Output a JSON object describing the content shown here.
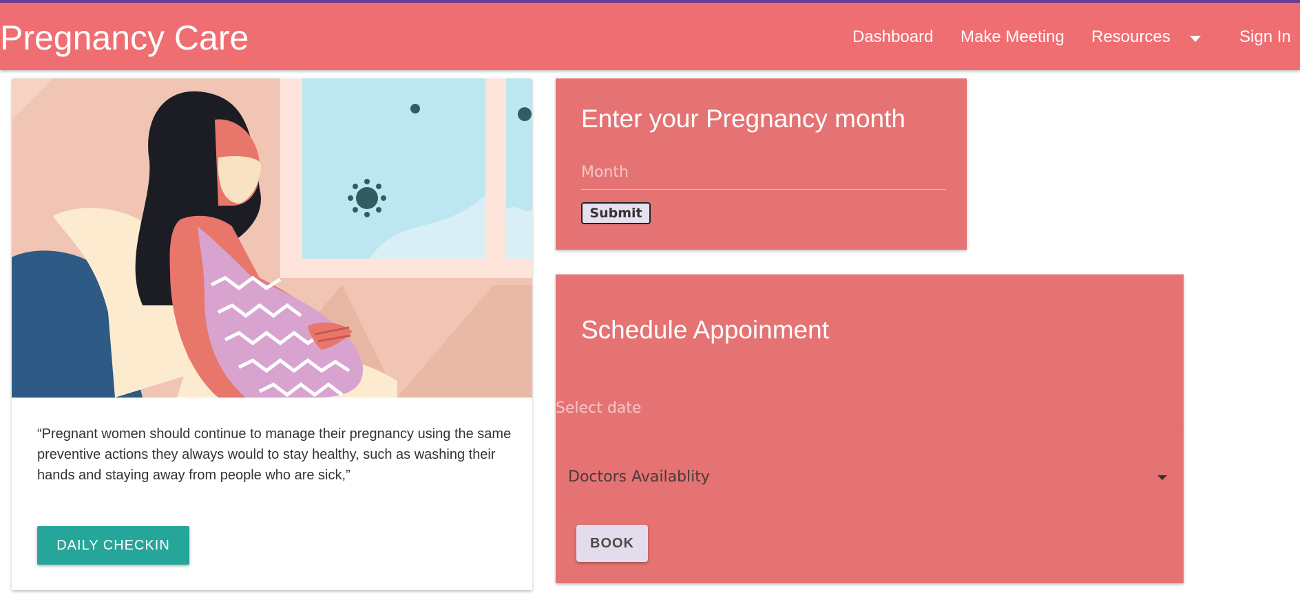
{
  "navbar": {
    "brand": "Pregnancy Care",
    "links": {
      "dashboard": "Dashboard",
      "make_meeting": "Make Meeting",
      "resources": "Resources",
      "sign_in": "Sign In"
    },
    "background": "#ef6e72"
  },
  "left_card": {
    "quote": "“Pregnant women should continue to manage their pregnancy using the same preventive actions they always would to stay healthy, such as washing their hands and staying away from people who are sick,”",
    "button_label": "DAILY CHECKIN",
    "button_color": "#26a69a"
  },
  "month_card": {
    "title": "Enter your Pregnancy month",
    "input_placeholder": "Month",
    "submit_label": "Submit",
    "background": "#e57373"
  },
  "schedule_card": {
    "title": "Schedule Appoinment",
    "date_placeholder": "Select date",
    "doctor_select": "Doctors Availablity",
    "book_label": "BOOK",
    "background": "#e57373"
  }
}
